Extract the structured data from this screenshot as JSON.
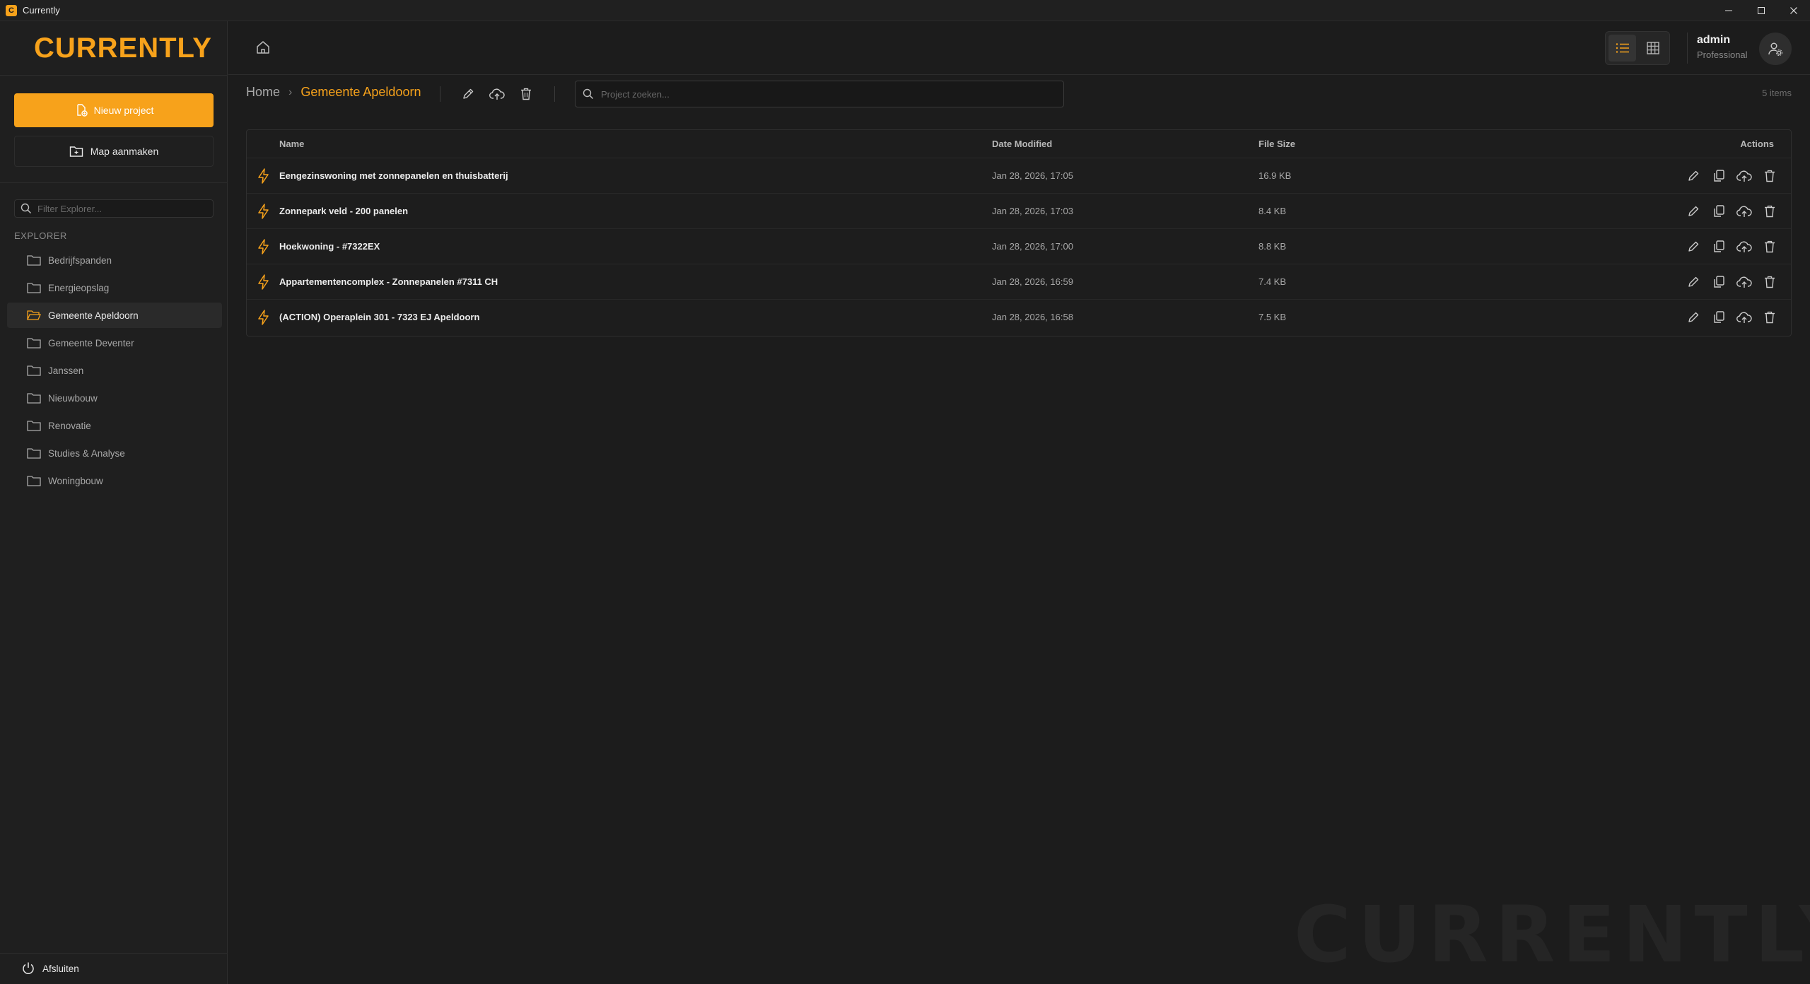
{
  "window": {
    "title": "Currently",
    "icon_letter": "C",
    "controls": {
      "minimize": "–",
      "maximize": "□",
      "close": "✕"
    }
  },
  "colors": {
    "accent": "#f7a21b",
    "background": "#1c1c1c",
    "sidebar": "#1f1f1f"
  },
  "sidebar": {
    "logo": "CURRENTLY",
    "new_project_label": "Nieuw project",
    "new_folder_label": "Map aanmaken",
    "filter_placeholder": "Filter Explorer...",
    "explorer_label": "EXPLORER",
    "folders": [
      {
        "label": "Bedrijfspanden",
        "active": false
      },
      {
        "label": "Energieopslag",
        "active": false
      },
      {
        "label": "Gemeente Apeldoorn",
        "active": true
      },
      {
        "label": "Gemeente Deventer",
        "active": false
      },
      {
        "label": "Janssen",
        "active": false
      },
      {
        "label": "Nieuwbouw",
        "active": false
      },
      {
        "label": "Renovatie",
        "active": false
      },
      {
        "label": "Studies & Analyse",
        "active": false
      },
      {
        "label": "Woningbouw",
        "active": false
      }
    ],
    "quit_label": "Afsluiten"
  },
  "header": {
    "user_name": "admin",
    "user_plan": "Professional",
    "view_mode": "list"
  },
  "toolbar": {
    "breadcrumb_home": "Home",
    "breadcrumb_sep": "›",
    "breadcrumb_current": "Gemeente Apeldoorn",
    "search_placeholder": "Project zoeken...",
    "item_count": "5 items"
  },
  "table": {
    "columns": {
      "name": "Name",
      "date": "Date Modified",
      "size": "File Size",
      "actions": "Actions"
    },
    "rows": [
      {
        "name": "Eengezinswoning met zonnepanelen en thuisbatterij",
        "date": "Jan 28, 2026, 17:05",
        "size": "16.9 KB"
      },
      {
        "name": "Zonnepark veld - 200 panelen",
        "date": "Jan 28, 2026, 17:03",
        "size": "8.4 KB"
      },
      {
        "name": "Hoekwoning - #7322EX",
        "date": "Jan 28, 2026, 17:00",
        "size": "8.8 KB"
      },
      {
        "name": "Appartementencomplex - Zonnepanelen #7311 CH",
        "date": "Jan 28, 2026, 16:59",
        "size": "7.4 KB"
      },
      {
        "name": "(ACTION) Operaplein 301 - 7323 EJ Apeldoorn",
        "date": "Jan 28, 2026, 16:58",
        "size": "7.5 KB"
      }
    ]
  },
  "watermark": "CURRENTLY",
  "icons": [
    "home-icon",
    "list-view-icon",
    "grid-view-icon",
    "user-settings-icon",
    "edit-icon",
    "cloud-upload-icon",
    "trash-icon",
    "search-icon",
    "folder-icon",
    "folder-open-icon",
    "bolt-icon",
    "copy-icon",
    "power-icon",
    "new-project-icon",
    "new-folder-icon"
  ]
}
